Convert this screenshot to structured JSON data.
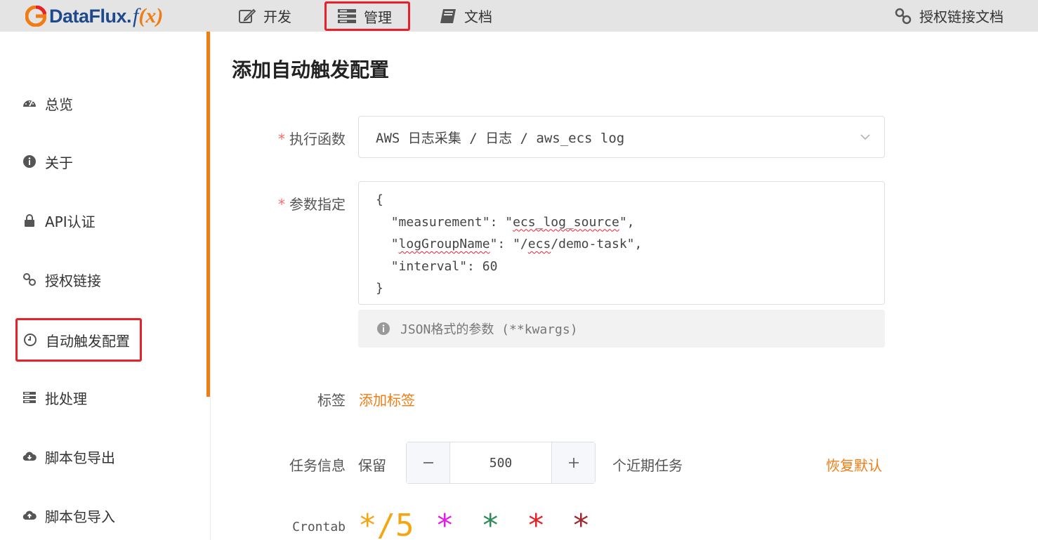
{
  "brand": {
    "name": "DataFlux.",
    "fx_f": "f",
    "fx_paren_open": "(",
    "fx_x": "x",
    "fx_paren_close": ")"
  },
  "topnav": {
    "dev": "开发",
    "manage": "管理",
    "docs": "文档",
    "auth_link_docs": "授权链接文档"
  },
  "sidebar": {
    "items": [
      {
        "label": "总览",
        "icon": "dashboard-icon"
      },
      {
        "label": "关于",
        "icon": "info-icon"
      },
      {
        "label": "API认证",
        "icon": "lock-icon"
      },
      {
        "label": "授权链接",
        "icon": "link-icon"
      },
      {
        "label": "自动触发配置",
        "icon": "clock-icon",
        "active": true
      },
      {
        "label": "批处理",
        "icon": "server-icon"
      },
      {
        "label": "脚本包导出",
        "icon": "cloud-download-icon"
      },
      {
        "label": "脚本包导入",
        "icon": "cloud-upload-icon"
      }
    ]
  },
  "form": {
    "title": "添加自动触发配置",
    "func_label": "执行函数",
    "func_value": "AWS 日志采集 / 日志 / aws_ecs log",
    "params_label": "参数指定",
    "params_lines": {
      "open": "{",
      "l1_key": "\"measurement\"",
      "l1_sep": ": \"",
      "l1_val": "ecs_log_source",
      "l1_end": "\",",
      "l2_q": "\"",
      "l2_key": "logGroupName",
      "l2_sep": "\": \"/",
      "l2_val": "ecs",
      "l2_end": "/demo-task\",",
      "l3": "\"interval\": 60",
      "close": "}"
    },
    "params_hint": "JSON格式的参数 (**kwargs)",
    "tags_label": "标签",
    "add_tag": "添加标签",
    "task_info_label": "任务信息",
    "keep_label": "保留",
    "keep_value": "500",
    "recent_tasks_label": "个近期任务",
    "restore_default": "恢复默认",
    "crontab_label": "Crontab",
    "crontab_parts": [
      "*/5",
      "*",
      "*",
      "*",
      "*"
    ]
  },
  "colors": {
    "accent": "#f07c13",
    "highlight_box": "#e8202a",
    "cron": [
      "#f5a511",
      "#e619e6",
      "#2e8b57",
      "#e8202a",
      "#a0282d"
    ]
  }
}
